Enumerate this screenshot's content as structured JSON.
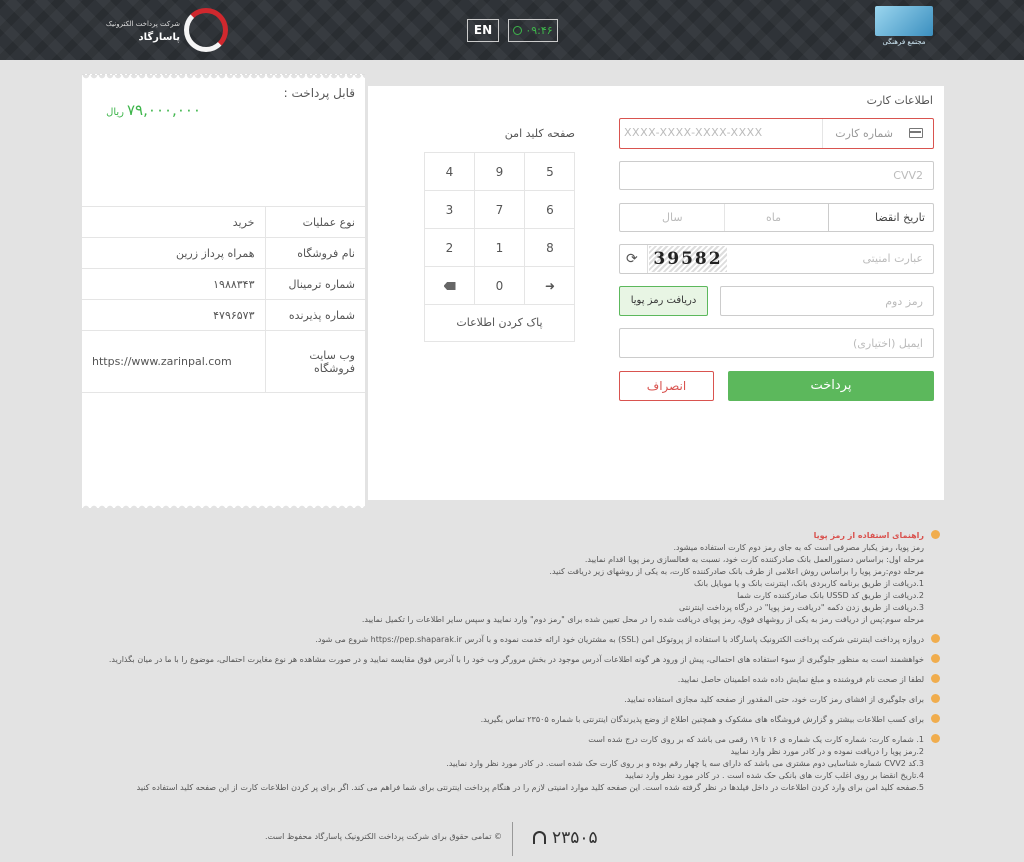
{
  "header": {
    "lang_label": "EN",
    "timer": "۰۹:۴۶",
    "logo_left_line1": "شرکت پرداخت الکترونیک",
    "logo_left_line2": "پاسارگاد",
    "logo_right_caption": "مجتمع فرهنگی"
  },
  "receipt": {
    "pay_label": "قابل پرداخت :",
    "amount": "۷۹,۰۰۰,۰۰۰",
    "currency": "ریال",
    "rows": [
      {
        "key": "نوع عملیات",
        "value": "خرید"
      },
      {
        "key": "نام فروشگاه",
        "value": "همراه پرداز زرین"
      },
      {
        "key": "شماره ترمینال",
        "value": "۱۹۸۸۳۴۳"
      },
      {
        "key": "شماره پذیرنده",
        "value": "۴۷۹۶۵۷۳"
      },
      {
        "key": "وب سایت فروشگاه",
        "value": "https://www.zarinpal.com"
      }
    ]
  },
  "form": {
    "title": "اطلاعات کارت",
    "card_label": "شماره کارت",
    "card_placeholder": "XXXX-XXXX-XXXX-XXXX",
    "cvv_placeholder": "CVV2",
    "expiry_label": "تاریخ انقضا",
    "month_placeholder": "ماه",
    "year_placeholder": "سال",
    "captcha_placeholder": "عبارت امنیتی",
    "captcha_text": "39582",
    "otp_button": "دریافت رمز پویا",
    "otp_placeholder": "رمز دوم",
    "email_placeholder": "ایمیل (اختیاری)",
    "pay_button": "پرداخت",
    "cancel_button": "انصراف"
  },
  "keypad": {
    "title": "صفحه کلید امن",
    "rows": [
      [
        "5",
        "9",
        "4"
      ],
      [
        "6",
        "7",
        "3"
      ],
      [
        "8",
        "1",
        "2"
      ]
    ],
    "zero": "0",
    "clear_label": "پاک کردن اطلاعات"
  },
  "guide": {
    "title": "راهنمای استفاده از رمز پویا",
    "intro_lines": [
      "رمز پویا، رمز یکبار مصرفی است که به جای رمز دوم کارت استفاده میشود.",
      "مرحله اول: براساس دستورالعمل بانک صادرکننده کارت خود، نسبت به فعالسازی رمز پویا اقدام نمایید.",
      "مرحله دوم:رمز پویا را براساس روش اعلامی از طرف بانک صادرکننده کارت، به یکی از روشهای زیر دریافت کنید.",
      "1.دریافت از طریق برنامه کاربردی بانک، اینترنت بانک و یا موبایل بانک",
      "2.دریافت از طریق کد USSD بانک صادرکننده کارت شما",
      "3.دریافت از طریق زدن دکمه \"دریافت رمز پویا\" در درگاه پرداخت اینترنتی",
      "مرحله سوم:پس از دریافت رمز به یکی از روشهای فوق، رمز پویای دریافت شده را در محل تعیین شده برای \"رمز دوم\" وارد نمایید و سپس سایر اطلاعات را تکمیل نمایید."
    ],
    "notes": [
      [
        "دروازه پرداخت اینترنتی شرکت پرداخت الکترونیک پاسارگاد با استفاده از پروتوکل امن (SSL) به مشتریان خود ارائه خدمت نموده و با آدرس https://pep.shaparak.ir شروع می شود."
      ],
      [
        "خواهشمند است به منظور جلوگیری از سوء استفاده های احتمالی، پیش از ورود هر گونه اطلاعات آدرس موجود در بخش مرورگر وب خود را با آدرس فوق مقایسه نمایید و در صورت مشاهده هر نوع مغایرت احتمالی، موضوع را با ما در میان بگذارید."
      ],
      [
        "لطفا از صحت نام فروشنده و مبلغ نمایش داده شده اطمینان حاصل نمایید."
      ],
      [
        "برای جلوگیری از افشای رمز کارت خود، حتی المقدور از صفحه کلید مجازی استفاده نمایید."
      ],
      [
        "برای کسب اطلاعات بیشتر و گزارش فروشگاه های مشکوک و همچنین اطلاع از وضع پذیرندگان اینترنتی با شماره ۲۳۵۰۵ تماس بگیرید."
      ],
      [
        "1. شماره کارت: شماره کارت یک شماره ی ۱۶ تا ۱۹ رقمی می باشد که بر روی کارت درج شده است",
        "2.رمز پویا را دریافت نموده و در کادر مورد نظر وارد نمایید",
        "3.کد CVV2 شماره شناسایی دوم مشتری می باشد که دارای سه یا چهار رقم بوده و بر روی کارت حک شده است. در کادر مورد نظر وارد نمایید.",
        "4.تاریخ انقضا بر روی اغلب کارت های بانکی حک شده است . در کادر مورد نظر وارد نمایید",
        "5.صفحه کلید امن برای وارد کردن اطلاعات در داخل فیلدها در نظر گرفته شده است. این صفحه کلید موارد امنیتی لازم را در هنگام پرداخت اینترنتی برای شما فراهم می کند. اگر برای پر کردن اطلاعات کارت از این صفحه کلید استفاده کنید"
      ]
    ]
  },
  "footer": {
    "copyright": "© تمامی حقوق برای شرکت پرداخت الکترونیک پاسارگاد محفوظ است.",
    "phone": "۲۳۵۰۵"
  }
}
